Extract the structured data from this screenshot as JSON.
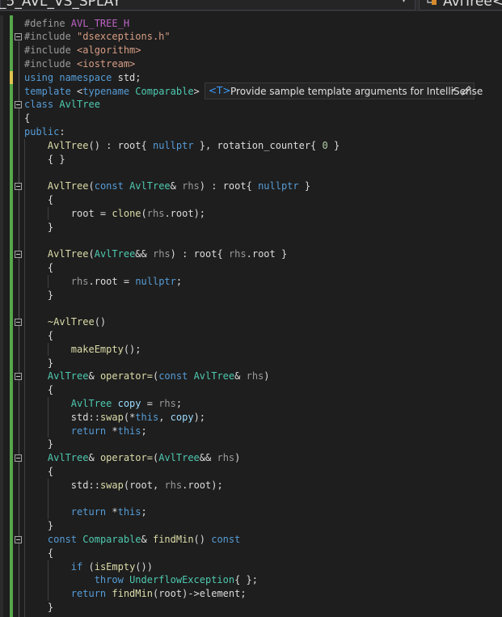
{
  "nav": {
    "file_text": "_5_AVL_VS_SPLAY",
    "dropdown_arrow": "▾",
    "scope_text": "AvlTree<C"
  },
  "hint": {
    "tag": "<T>",
    "text": "Provide sample template arguments for IntelliSense",
    "arrow": "▾"
  },
  "code": [
    [
      [
        "#define ",
        "pp"
      ],
      [
        "AVL_TREE_H",
        "mc"
      ]
    ],
    [
      [
        "#include ",
        "pp"
      ],
      [
        "\"dsexceptions.h\"",
        "st"
      ]
    ],
    [
      [
        "#include ",
        "pp"
      ],
      [
        "<algorithm>",
        "st"
      ]
    ],
    [
      [
        "#include ",
        "pp"
      ],
      [
        "<iostream>",
        "st"
      ]
    ],
    [
      [
        "using namespace ",
        "kw"
      ],
      [
        "std",
        "df"
      ],
      [
        ";",
        "df"
      ]
    ],
    [
      [
        "template ",
        "kw"
      ],
      [
        "<",
        "df"
      ],
      [
        "typename ",
        "kw"
      ],
      [
        "Comparable",
        "ty"
      ],
      [
        ">",
        "df"
      ]
    ],
    [
      [
        "class ",
        "kw"
      ],
      [
        "AvlTree",
        "ty"
      ]
    ],
    [
      [
        "{",
        "df"
      ]
    ],
    [
      [
        "public",
        "kw"
      ],
      [
        ":",
        "df"
      ]
    ],
    [
      [
        "    ",
        "df"
      ],
      [
        "AvlTree",
        "fn"
      ],
      [
        "() : ",
        "df"
      ],
      [
        "root",
        "df"
      ],
      [
        "{ ",
        "df"
      ],
      [
        "nullptr",
        "kw"
      ],
      [
        " }, ",
        "df"
      ],
      [
        "rotation_counter",
        "df"
      ],
      [
        "{ ",
        "df"
      ],
      [
        "0",
        "nu"
      ],
      [
        " }",
        "df"
      ]
    ],
    [
      [
        "    ",
        "df"
      ],
      [
        "{ }",
        "df"
      ]
    ],
    [],
    [
      [
        "    ",
        "df"
      ],
      [
        "AvlTree",
        "fn"
      ],
      [
        "(",
        "df"
      ],
      [
        "const ",
        "kw"
      ],
      [
        "AvlTree",
        "ty"
      ],
      [
        "& ",
        "df"
      ],
      [
        "rhs",
        "pa"
      ],
      [
        ") : ",
        "df"
      ],
      [
        "root",
        "df"
      ],
      [
        "{ ",
        "df"
      ],
      [
        "nullptr",
        "kw"
      ],
      [
        " }",
        "df"
      ]
    ],
    [
      [
        "    ",
        "df"
      ],
      [
        "{",
        "df"
      ]
    ],
    [
      [
        "        ",
        "df"
      ],
      [
        "root",
        "df"
      ],
      [
        " = ",
        "df"
      ],
      [
        "clone",
        "fn"
      ],
      [
        "(",
        "df"
      ],
      [
        "rhs",
        "pa"
      ],
      [
        ".",
        "df"
      ],
      [
        "root",
        "df"
      ],
      [
        ");",
        "df"
      ]
    ],
    [
      [
        "    ",
        "df"
      ],
      [
        "}",
        "df"
      ]
    ],
    [],
    [
      [
        "    ",
        "df"
      ],
      [
        "AvlTree",
        "fn"
      ],
      [
        "(",
        "df"
      ],
      [
        "AvlTree",
        "ty"
      ],
      [
        "&& ",
        "df"
      ],
      [
        "rhs",
        "pa"
      ],
      [
        ") : ",
        "df"
      ],
      [
        "root",
        "df"
      ],
      [
        "{ ",
        "df"
      ],
      [
        "rhs",
        "pa"
      ],
      [
        ".",
        "df"
      ],
      [
        "root",
        "df"
      ],
      [
        " }",
        "df"
      ]
    ],
    [
      [
        "    ",
        "df"
      ],
      [
        "{",
        "df"
      ]
    ],
    [
      [
        "        ",
        "df"
      ],
      [
        "rhs",
        "pa"
      ],
      [
        ".",
        "df"
      ],
      [
        "root",
        "df"
      ],
      [
        " = ",
        "df"
      ],
      [
        "nullptr",
        "kw"
      ],
      [
        ";",
        "df"
      ]
    ],
    [
      [
        "    ",
        "df"
      ],
      [
        "}",
        "df"
      ]
    ],
    [],
    [
      [
        "    ",
        "df"
      ],
      [
        "~AvlTree",
        "fn"
      ],
      [
        "()",
        "df"
      ]
    ],
    [
      [
        "    ",
        "df"
      ],
      [
        "{",
        "df"
      ]
    ],
    [
      [
        "        ",
        "df"
      ],
      [
        "makeEmpty",
        "fn"
      ],
      [
        "();",
        "df"
      ]
    ],
    [
      [
        "    ",
        "df"
      ],
      [
        "}",
        "df"
      ]
    ],
    [
      [
        "    ",
        "df"
      ],
      [
        "AvlTree",
        "ty"
      ],
      [
        "& ",
        "df"
      ],
      [
        "operator=",
        "fn"
      ],
      [
        "(",
        "df"
      ],
      [
        "const ",
        "kw"
      ],
      [
        "AvlTree",
        "ty"
      ],
      [
        "& ",
        "df"
      ],
      [
        "rhs",
        "pa"
      ],
      [
        ")",
        "df"
      ]
    ],
    [
      [
        "    ",
        "df"
      ],
      [
        "{",
        "df"
      ]
    ],
    [
      [
        "        ",
        "df"
      ],
      [
        "AvlTree ",
        "ty"
      ],
      [
        "copy",
        "vr"
      ],
      [
        " = ",
        "df"
      ],
      [
        "rhs",
        "pa"
      ],
      [
        ";",
        "df"
      ]
    ],
    [
      [
        "        ",
        "df"
      ],
      [
        "std",
        "df"
      ],
      [
        "::",
        "df"
      ],
      [
        "swap",
        "fn"
      ],
      [
        "(*",
        "df"
      ],
      [
        "this",
        "kw"
      ],
      [
        ", ",
        "df"
      ],
      [
        "copy",
        "vr"
      ],
      [
        ");",
        "df"
      ]
    ],
    [
      [
        "        ",
        "df"
      ],
      [
        "return ",
        "kw"
      ],
      [
        "*",
        "df"
      ],
      [
        "this",
        "kw"
      ],
      [
        ";",
        "df"
      ]
    ],
    [
      [
        "    ",
        "df"
      ],
      [
        "}",
        "df"
      ]
    ],
    [
      [
        "    ",
        "df"
      ],
      [
        "AvlTree",
        "ty"
      ],
      [
        "& ",
        "df"
      ],
      [
        "operator=",
        "fn"
      ],
      [
        "(",
        "df"
      ],
      [
        "AvlTree",
        "ty"
      ],
      [
        "&& ",
        "df"
      ],
      [
        "rhs",
        "pa"
      ],
      [
        ")",
        "df"
      ]
    ],
    [
      [
        "    ",
        "df"
      ],
      [
        "{",
        "df"
      ]
    ],
    [
      [
        "        ",
        "df"
      ],
      [
        "std",
        "df"
      ],
      [
        "::",
        "df"
      ],
      [
        "swap",
        "fn"
      ],
      [
        "(",
        "df"
      ],
      [
        "root",
        "df"
      ],
      [
        ", ",
        "df"
      ],
      [
        "rhs",
        "pa"
      ],
      [
        ".",
        "df"
      ],
      [
        "root",
        "df"
      ],
      [
        ");",
        "df"
      ]
    ],
    [],
    [
      [
        "        ",
        "df"
      ],
      [
        "return ",
        "kw"
      ],
      [
        "*",
        "df"
      ],
      [
        "this",
        "kw"
      ],
      [
        ";",
        "df"
      ]
    ],
    [
      [
        "    ",
        "df"
      ],
      [
        "}",
        "df"
      ]
    ],
    [
      [
        "    ",
        "df"
      ],
      [
        "const ",
        "kw"
      ],
      [
        "Comparable",
        "ty"
      ],
      [
        "& ",
        "df"
      ],
      [
        "findMin",
        "fn"
      ],
      [
        "() ",
        "df"
      ],
      [
        "const",
        "kw"
      ]
    ],
    [
      [
        "    ",
        "df"
      ],
      [
        "{",
        "df"
      ]
    ],
    [
      [
        "        ",
        "df"
      ],
      [
        "if ",
        "kw"
      ],
      [
        "(",
        "df"
      ],
      [
        "isEmpty",
        "fn"
      ],
      [
        "())",
        "df"
      ]
    ],
    [
      [
        "            ",
        "df"
      ],
      [
        "throw ",
        "kw"
      ],
      [
        "UnderflowException",
        "ty"
      ],
      [
        "{ };",
        "df"
      ]
    ],
    [
      [
        "        ",
        "df"
      ],
      [
        "return ",
        "kw"
      ],
      [
        "findMin",
        "fn"
      ],
      [
        "(",
        "df"
      ],
      [
        "root",
        "df"
      ],
      [
        ")->",
        "df"
      ],
      [
        "element",
        "df"
      ],
      [
        ";",
        "df"
      ]
    ],
    [
      [
        "    ",
        "df"
      ],
      [
        "}",
        "df"
      ]
    ]
  ],
  "colors": {
    "background": "#1e1e1e",
    "keyword": "#569cd6",
    "type": "#4ec9b0",
    "function": "#dcdcaa",
    "string": "#d69d85",
    "macro": "#bd63c5",
    "number": "#b5cea8",
    "preprocessor": "#9b9b9b",
    "variable": "#9cdcfe",
    "parameter": "#9a9a9a",
    "plain": "#dcdcdc",
    "change_saved": "#57a64a",
    "change_unsaved": "#e0c44e"
  },
  "icons": {
    "scope": "class-member-icon",
    "hint_edit": "pencil-icon",
    "fold": "collapse-icon"
  }
}
